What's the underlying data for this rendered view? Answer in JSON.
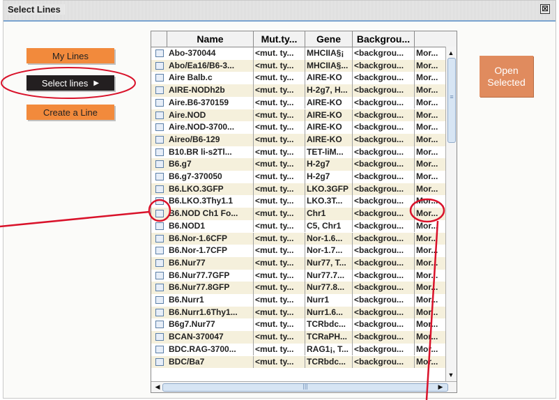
{
  "window": {
    "title": "Select Lines",
    "close_glyph": "⊠"
  },
  "sidebar": {
    "my_lines": "My Lines",
    "select_lines": "Select lines",
    "select_arrow": "▶",
    "create_line": "Create a Line"
  },
  "open_selected": "Open\nSelected",
  "table": {
    "headers": [
      "",
      "Name",
      "Mut.ty...",
      "Gene",
      "Backgrou...",
      ""
    ],
    "rows": [
      [
        "Abo-370044",
        "<mut. ty...",
        "MHCIIA§¡",
        "<backgrou...",
        "Mor..."
      ],
      [
        "Abo/Ea16/B6-3...",
        "<mut. ty...",
        "MHCIIA§...",
        "<backgrou...",
        "Mor..."
      ],
      [
        "Aire Balb.c",
        "<mut. ty...",
        "AIRE-KO",
        "<backgrou...",
        "Mor..."
      ],
      [
        "AIRE-NODh2b",
        "<mut. ty...",
        "H-2g7, H...",
        "<backgrou...",
        "Mor..."
      ],
      [
        "Aire.B6-370159",
        "<mut. ty...",
        "AIRE-KO",
        "<backgrou...",
        "Mor..."
      ],
      [
        "Aire.NOD",
        "<mut. ty...",
        "AIRE-KO",
        "<backgrou...",
        "Mor..."
      ],
      [
        "Aire.NOD-3700...",
        "<mut. ty...",
        "AIRE-KO",
        "<backgrou...",
        "Mor..."
      ],
      [
        "Aireo/B6-129",
        "<mut. ty...",
        "AIRE-KO",
        "<backgrou...",
        "Mor..."
      ],
      [
        "B10.BR li-s2Tl...",
        "<mut. ty...",
        "TET-liM...",
        "<backgrou...",
        "Mor..."
      ],
      [
        "B6.g7",
        "<mut. ty...",
        "H-2g7",
        "<backgrou...",
        "Mor..."
      ],
      [
        "B6.g7-370050",
        "<mut. ty...",
        "H-2g7",
        "<backgrou...",
        "Mor..."
      ],
      [
        "B6.LKO.3GFP",
        "<mut. ty...",
        "LKO.3GFP",
        "<backgrou...",
        "Mor..."
      ],
      [
        "B6.LKO.3Thy1.1",
        "<mut. ty...",
        "LKO.3T...",
        "<backgrou...",
        "Mor..."
      ],
      [
        "B6.NOD Ch1 Fo...",
        "<mut. ty...",
        "Chr1",
        "<backgrou...",
        "Mor..."
      ],
      [
        "B6.NOD1",
        "<mut. ty...",
        "C5, Chr1",
        "<backgrou...",
        "Mor..."
      ],
      [
        "B6.Nor-1.6CFP",
        "<mut. ty...",
        "Nor-1.6...",
        "<backgrou...",
        "Mor..."
      ],
      [
        "B6.Nor-1.7CFP",
        "<mut. ty...",
        "Nor-1.7...",
        "<backgrou...",
        "Mor..."
      ],
      [
        "B6.Nur77",
        "<mut. ty...",
        "Nur77, T...",
        "<backgrou...",
        "Mor..."
      ],
      [
        "B6.Nur77.7GFP",
        "<mut. ty...",
        "Nur77.7...",
        "<backgrou...",
        "Mor..."
      ],
      [
        "B6.Nur77.8GFP",
        "<mut. ty...",
        "Nur77.8...",
        "<backgrou...",
        "Mor..."
      ],
      [
        "B6.Nurr1",
        "<mut. ty...",
        "Nurr1",
        "<backgrou...",
        "Mor..."
      ],
      [
        "B6.Nurr1.6Thy1...",
        "<mut. ty...",
        "Nurr1.6...",
        "<backgrou...",
        "Mor..."
      ],
      [
        "B6g7.Nur77",
        "<mut. ty...",
        "TCRbdc...",
        "<backgrou...",
        "Mor..."
      ],
      [
        "BCAN-370047",
        "<mut. ty...",
        "TCRaPH...",
        "<backgrou...",
        "Mor..."
      ],
      [
        "BDC.RAG-3700...",
        "<mut. ty...",
        "RAG1¡, T...",
        "<backgrou...",
        "Mor..."
      ],
      [
        "BDC/Ba7",
        "<mut. ty...",
        "TCRbdc...",
        "<backgrou...",
        "Mor..."
      ]
    ]
  },
  "scroll": {
    "up": "▲",
    "down": "▼",
    "left": "◀",
    "right": "▶",
    "grip": "≡",
    "hgrip": "|||"
  },
  "colors": {
    "annotation_red": "#d9122a",
    "accent_orange": "#f28a3c",
    "row_alt": "#f5f0dc"
  }
}
